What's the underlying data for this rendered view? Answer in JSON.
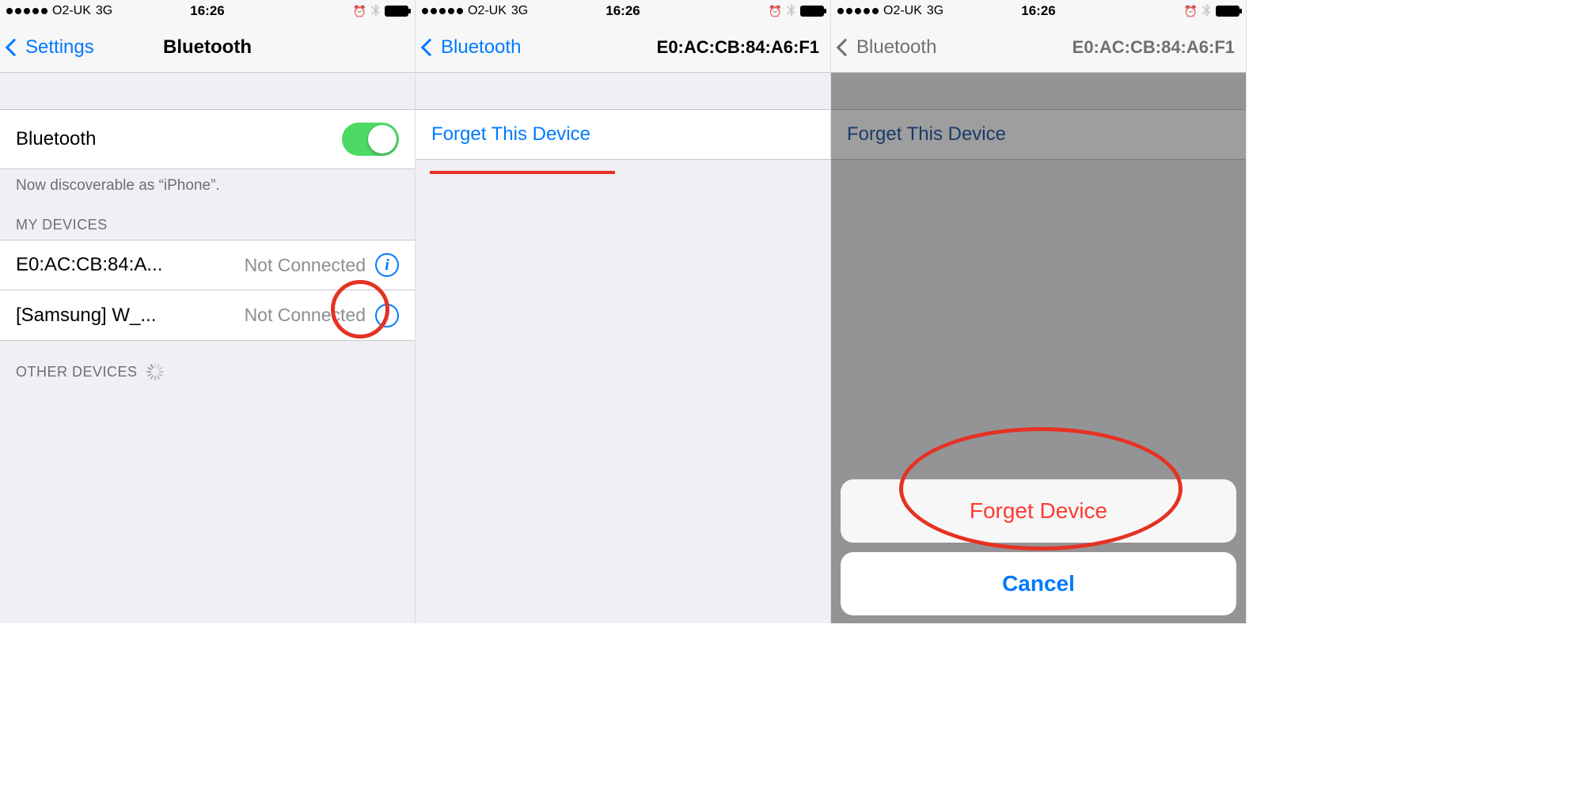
{
  "status": {
    "carrier": "O2-UK",
    "network": "3G",
    "time": "16:26"
  },
  "screen1": {
    "back_label": "Settings",
    "title": "Bluetooth",
    "bt_row_label": "Bluetooth",
    "discoverable_text": "Now discoverable as “iPhone”.",
    "my_devices_header": "MY DEVICES",
    "devices": [
      {
        "name": "E0:AC:CB:84:A...",
        "status": "Not Connected"
      },
      {
        "name": "[Samsung] W_...",
        "status": "Not Connected"
      }
    ],
    "other_devices_header": "OTHER DEVICES"
  },
  "screen2": {
    "back_label": "Bluetooth",
    "title": "E0:AC:CB:84:A6:F1",
    "forget_label": "Forget This Device"
  },
  "screen3": {
    "back_label": "Bluetooth",
    "title": "E0:AC:CB:84:A6:F1",
    "forget_label": "Forget This Device",
    "sheet": {
      "forget": "Forget Device",
      "cancel": "Cancel"
    }
  }
}
